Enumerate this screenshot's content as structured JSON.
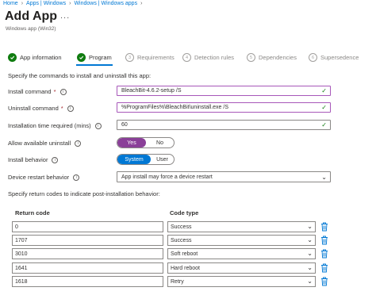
{
  "breadcrumb": [
    "Home",
    "Apps | Windows",
    "Windows | Windows apps"
  ],
  "page": {
    "title": "Add App",
    "more": "...",
    "subtitle": "Windows app (Win32)"
  },
  "steps": [
    {
      "label": "App information",
      "state": "done"
    },
    {
      "label": "Program",
      "state": "active"
    },
    {
      "label": "Requirements",
      "state": "pending",
      "num": "3"
    },
    {
      "label": "Detection rules",
      "state": "pending",
      "num": "4"
    },
    {
      "label": "Dependencies",
      "state": "pending",
      "num": "5"
    },
    {
      "label": "Supersedence",
      "state": "pending",
      "num": "6"
    }
  ],
  "intro": "Specify the commands to install and uninstall this app:",
  "form": {
    "install_command": {
      "label": "Install command",
      "required": "*",
      "value": "BleachBit-4.6.2-setup /S"
    },
    "uninstall_command": {
      "label": "Uninstall command",
      "required": "*",
      "value": "%ProgramFiles%\\BleachBit\\uninstall.exe /S"
    },
    "install_time": {
      "label": "Installation time required (mins)",
      "value": "60"
    },
    "allow_uninstall": {
      "label": "Allow available uninstall",
      "on": "Yes",
      "off": "No",
      "selected": "Yes"
    },
    "install_behavior": {
      "label": "Install behavior",
      "on": "System",
      "off": "User",
      "selected": "System"
    },
    "restart_behavior": {
      "label": "Device restart behavior",
      "value": "App install may force a device restart"
    }
  },
  "return_codes": {
    "intro": "Specify return codes to indicate post-installation behavior:",
    "col_code": "Return code",
    "col_type": "Code type",
    "rows": [
      {
        "code": "0",
        "type": "Success"
      },
      {
        "code": "1707",
        "type": "Success"
      },
      {
        "code": "3010",
        "type": "Soft reboot"
      },
      {
        "code": "1641",
        "type": "Hard reboot"
      },
      {
        "code": "1618",
        "type": "Retry"
      }
    ]
  },
  "colors": {
    "accent": "#0078d4",
    "success": "#107c10",
    "toggle_selected": "#8a3f98",
    "highlight_border": "#a757b9"
  }
}
